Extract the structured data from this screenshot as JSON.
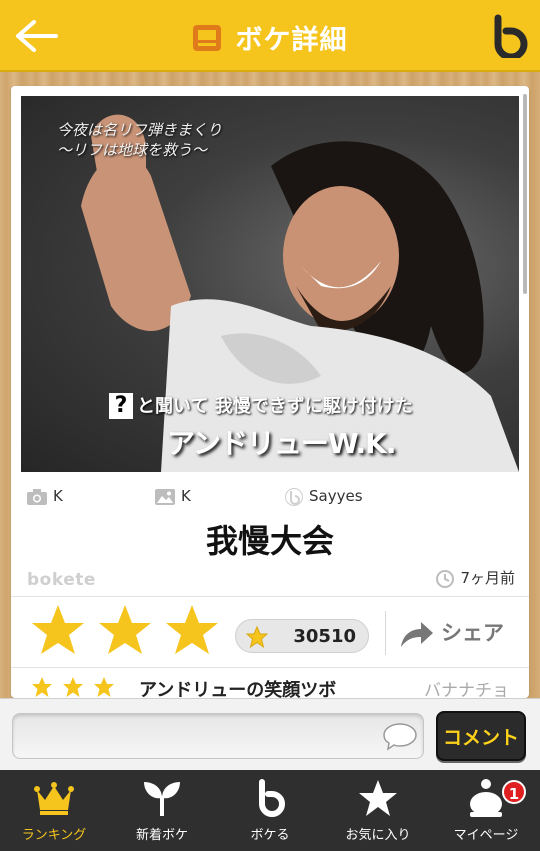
{
  "header": {
    "title": "ボケ詳細",
    "brand_color": "#f5c51d"
  },
  "post": {
    "photo": {
      "caption_top_line1": "今夜は名リフ弾きまくり",
      "caption_top_line2": "〜リフは地球を救う〜",
      "caption_question": "と聞いて 我慢できずに駆け付けた",
      "caption_big": "アンドリューW.K."
    },
    "meta": {
      "camera_user": "K",
      "image_user": "K",
      "boke_user": "Sayyes"
    },
    "title": "我慢大会",
    "watermark": "bokete",
    "time_ago": "7ヶ月前",
    "rating": {
      "stars": 3,
      "score": "30510"
    },
    "share_label": "シェア",
    "top_comment": {
      "stars": 3,
      "text": "アンドリューの笑顔ツボ",
      "user": "バナナチョ"
    }
  },
  "comment_bar": {
    "placeholder": "",
    "button_label": "コメント"
  },
  "nav": {
    "items": [
      {
        "label": "ランキング",
        "icon": "crown-icon",
        "active": true
      },
      {
        "label": "新着ボケ",
        "icon": "sprout-icon"
      },
      {
        "label": "ボケる",
        "icon": "bokete-b-icon"
      },
      {
        "label": "お気に入り",
        "icon": "star-icon"
      },
      {
        "label": "マイページ",
        "icon": "user-icon",
        "badge": "1"
      }
    ]
  }
}
